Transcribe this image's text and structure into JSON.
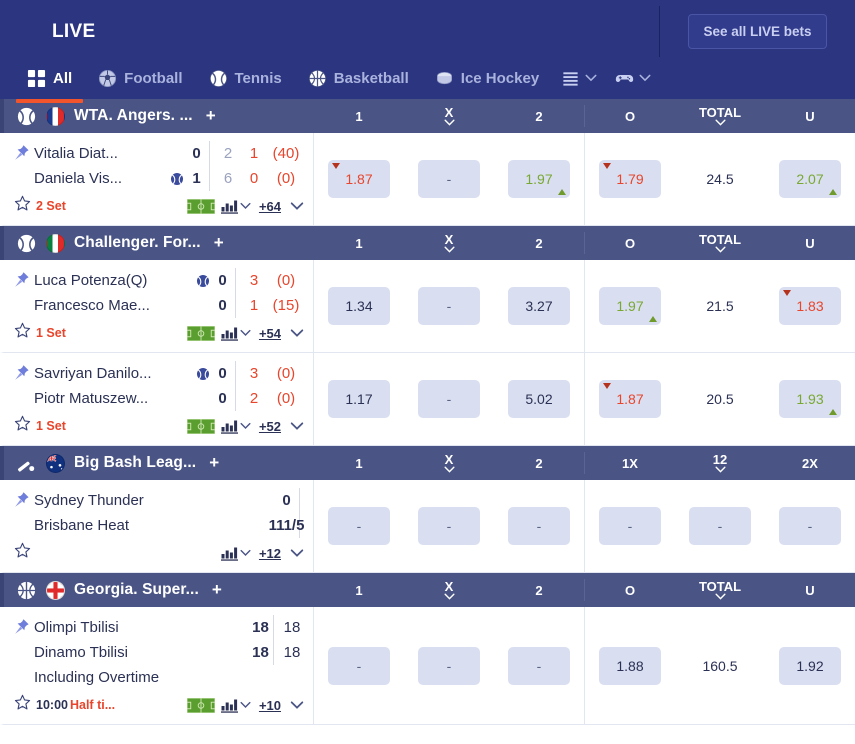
{
  "header": {
    "live_label": "LIVE",
    "see_all_label": "See all LIVE bets",
    "accent_color": "#f2552c",
    "bg_color": "#2b3580"
  },
  "tabs": [
    {
      "label": "All",
      "icon": "grid-icon",
      "active": true
    },
    {
      "label": "Football",
      "icon": "football-icon",
      "active": false
    },
    {
      "label": "Tennis",
      "icon": "tennis-ball-icon",
      "active": false
    },
    {
      "label": "Basketball",
      "icon": "basketball-icon",
      "active": false
    },
    {
      "label": "Ice Hockey",
      "icon": "ice-hockey-icon",
      "active": false
    },
    {
      "label": "",
      "icon": "list-menu-icon",
      "active": false,
      "chevron": true
    },
    {
      "label": "",
      "icon": "gamepad-icon",
      "active": false,
      "chevron": true
    }
  ],
  "leagues": [
    {
      "name": "WTA. Angers. ...",
      "sport_icon": "tennis-ball-icon",
      "flag": "france-flag",
      "plus_label": "+",
      "columns": [
        "1",
        "X",
        "2",
        "O",
        "TOTAL",
        "U"
      ],
      "column_chevrons": [
        false,
        true,
        false,
        false,
        true,
        false
      ],
      "matches": [
        {
          "team1": "Vitalia Diat...",
          "team2": "Daniela Vis...",
          "extra": "",
          "serving": 2,
          "scores": [
            {
              "main": "0",
              "cells": [
                "2",
                "1",
                "(40)"
              ]
            },
            {
              "main": "1",
              "cells": [
                "6",
                "0",
                "(0)"
              ]
            }
          ],
          "score_styles": [
            "s-grey",
            "s-red",
            "s-red"
          ],
          "status": "2 Set",
          "time": "",
          "has_pitch": true,
          "more_count": "+64",
          "odds": [
            {
              "value": "1.87",
              "state": "red",
              "arrow": "down"
            },
            {
              "value": "-",
              "state": "dash",
              "arrow": ""
            },
            {
              "value": "1.97",
              "state": "green",
              "arrow": "up"
            },
            {
              "value": "1.79",
              "state": "red",
              "arrow": "down"
            },
            {
              "value": "24.5",
              "state": "total",
              "arrow": ""
            },
            {
              "value": "2.07",
              "state": "green",
              "arrow": "up"
            }
          ]
        }
      ]
    },
    {
      "name": "Challenger. For...",
      "sport_icon": "tennis-ball-icon",
      "flag": "italy-flag",
      "plus_label": "+",
      "columns": [
        "1",
        "X",
        "2",
        "O",
        "TOTAL",
        "U"
      ],
      "column_chevrons": [
        false,
        true,
        false,
        false,
        true,
        false
      ],
      "matches": [
        {
          "team1": "Luca Potenza(Q)",
          "team2": "Francesco Mae...",
          "extra": "",
          "serving": 1,
          "scores": [
            {
              "main": "0",
              "cells": [
                "3",
                "(0)"
              ]
            },
            {
              "main": "0",
              "cells": [
                "1",
                "(15)"
              ]
            }
          ],
          "score_styles": [
            "s-red",
            "s-red"
          ],
          "status": "1 Set",
          "time": "",
          "has_pitch": true,
          "more_count": "+54",
          "odds": [
            {
              "value": "1.34",
              "state": "plain",
              "arrow": ""
            },
            {
              "value": "-",
              "state": "dash",
              "arrow": ""
            },
            {
              "value": "3.27",
              "state": "plain",
              "arrow": ""
            },
            {
              "value": "1.97",
              "state": "green",
              "arrow": "up"
            },
            {
              "value": "21.5",
              "state": "total",
              "arrow": ""
            },
            {
              "value": "1.83",
              "state": "red",
              "arrow": "down"
            }
          ]
        },
        {
          "team1": "Savriyan Danilo...",
          "team2": "Piotr Matuszew...",
          "extra": "",
          "serving": 1,
          "scores": [
            {
              "main": "0",
              "cells": [
                "3",
                "(0)"
              ]
            },
            {
              "main": "0",
              "cells": [
                "2",
                "(0)"
              ]
            }
          ],
          "score_styles": [
            "s-red",
            "s-red"
          ],
          "status": "1 Set",
          "time": "",
          "has_pitch": true,
          "more_count": "+52",
          "odds": [
            {
              "value": "1.17",
              "state": "plain",
              "arrow": ""
            },
            {
              "value": "-",
              "state": "dash",
              "arrow": ""
            },
            {
              "value": "5.02",
              "state": "plain",
              "arrow": ""
            },
            {
              "value": "1.87",
              "state": "red",
              "arrow": "down"
            },
            {
              "value": "20.5",
              "state": "total",
              "arrow": ""
            },
            {
              "value": "1.93",
              "state": "green",
              "arrow": "up"
            }
          ]
        }
      ]
    },
    {
      "name": "Big Bash Leag...",
      "sport_icon": "cricket-icon",
      "flag": "australia-flag",
      "plus_label": "+",
      "columns": [
        "1",
        "X",
        "2",
        "1X",
        "12",
        "2X"
      ],
      "column_chevrons": [
        false,
        true,
        false,
        false,
        true,
        false
      ],
      "matches": [
        {
          "team1": "Sydney Thunder",
          "team2": "Brisbane Heat",
          "extra": "",
          "serving": 0,
          "scores": [
            {
              "main": "0",
              "cells": []
            },
            {
              "main": "111/5",
              "cells": []
            }
          ],
          "score_styles": [],
          "status": "",
          "time": "",
          "has_pitch": false,
          "more_count": "+12",
          "odds": [
            {
              "value": "-",
              "state": "dash",
              "arrow": ""
            },
            {
              "value": "-",
              "state": "dash",
              "arrow": ""
            },
            {
              "value": "-",
              "state": "dash",
              "arrow": ""
            },
            {
              "value": "-",
              "state": "dash",
              "arrow": ""
            },
            {
              "value": "-",
              "state": "dash",
              "arrow": ""
            },
            {
              "value": "-",
              "state": "dash",
              "arrow": ""
            }
          ]
        }
      ]
    },
    {
      "name": "Georgia. Super...",
      "sport_icon": "basketball-icon",
      "flag": "georgia-flag",
      "plus_label": "+",
      "columns": [
        "1",
        "X",
        "2",
        "O",
        "TOTAL",
        "U"
      ],
      "column_chevrons": [
        false,
        true,
        false,
        false,
        true,
        false
      ],
      "matches": [
        {
          "team1": "Olimpi Tbilisi",
          "team2": "Dinamo Tbilisi",
          "extra": "Including Overtime",
          "serving": 0,
          "scores": [
            {
              "main": "18",
              "cells": [
                "18"
              ]
            },
            {
              "main": "18",
              "cells": [
                "18"
              ]
            }
          ],
          "score_styles": [
            "s-dark"
          ],
          "status": "Half ti...",
          "time": "10:00",
          "has_pitch": true,
          "more_count": "+10",
          "odds": [
            {
              "value": "-",
              "state": "dash",
              "arrow": ""
            },
            {
              "value": "-",
              "state": "dash",
              "arrow": ""
            },
            {
              "value": "-",
              "state": "dash",
              "arrow": ""
            },
            {
              "value": "1.88",
              "state": "plain",
              "arrow": ""
            },
            {
              "value": "160.5",
              "state": "total",
              "arrow": ""
            },
            {
              "value": "1.92",
              "state": "plain",
              "arrow": ""
            }
          ]
        }
      ]
    }
  ]
}
